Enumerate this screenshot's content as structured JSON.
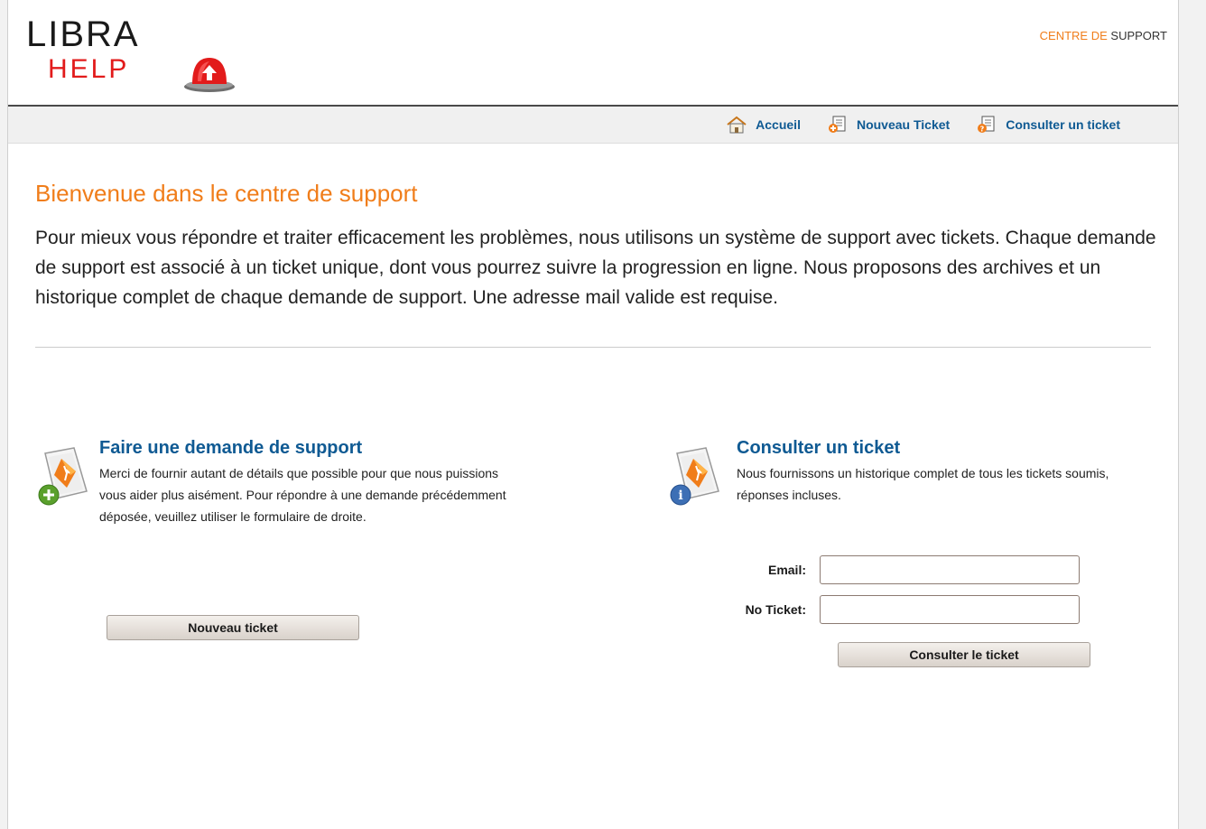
{
  "header": {
    "logo_line1": "LIBRA",
    "logo_line2": "HELP",
    "site_title_accent": "CENTRE DE",
    "site_title_rest": " SUPPORT"
  },
  "nav": {
    "items": [
      {
        "label": "Accueil",
        "icon": "home-icon"
      },
      {
        "label": "Nouveau Ticket",
        "icon": "new-ticket-icon"
      },
      {
        "label": "Consulter un ticket",
        "icon": "check-ticket-icon"
      }
    ]
  },
  "main": {
    "title": "Bienvenue dans le centre de support",
    "intro": "Pour mieux vous répondre et traiter efficacement les problèmes, nous utilisons un système de support avec tickets. Chaque demande de support est associé à un ticket unique, dont vous pourrez suivre la progression en ligne. Nous proposons des archives et un historique complet de chaque demande de support. Une adresse mail valide est requise."
  },
  "new_ticket_panel": {
    "heading": "Faire une demande de support",
    "text": "Merci de fournir autant de détails que possible pour que nous puissions vous aider plus aisément. Pour répondre à une demande précédemment déposée, veuillez utiliser le formulaire de droite.",
    "button_label": "Nouveau ticket"
  },
  "check_ticket_panel": {
    "heading": "Consulter un ticket",
    "text": "Nous fournissons un historique complet de tous les tickets soumis, réponses incluses.",
    "email_label": "Email:",
    "email_value": "",
    "ticket_label": "No Ticket:",
    "ticket_value": "",
    "button_label": "Consulter le ticket"
  },
  "colors": {
    "accent": "#f07d1a",
    "link": "#0f5a93",
    "logo_red": "#e21b1b"
  }
}
